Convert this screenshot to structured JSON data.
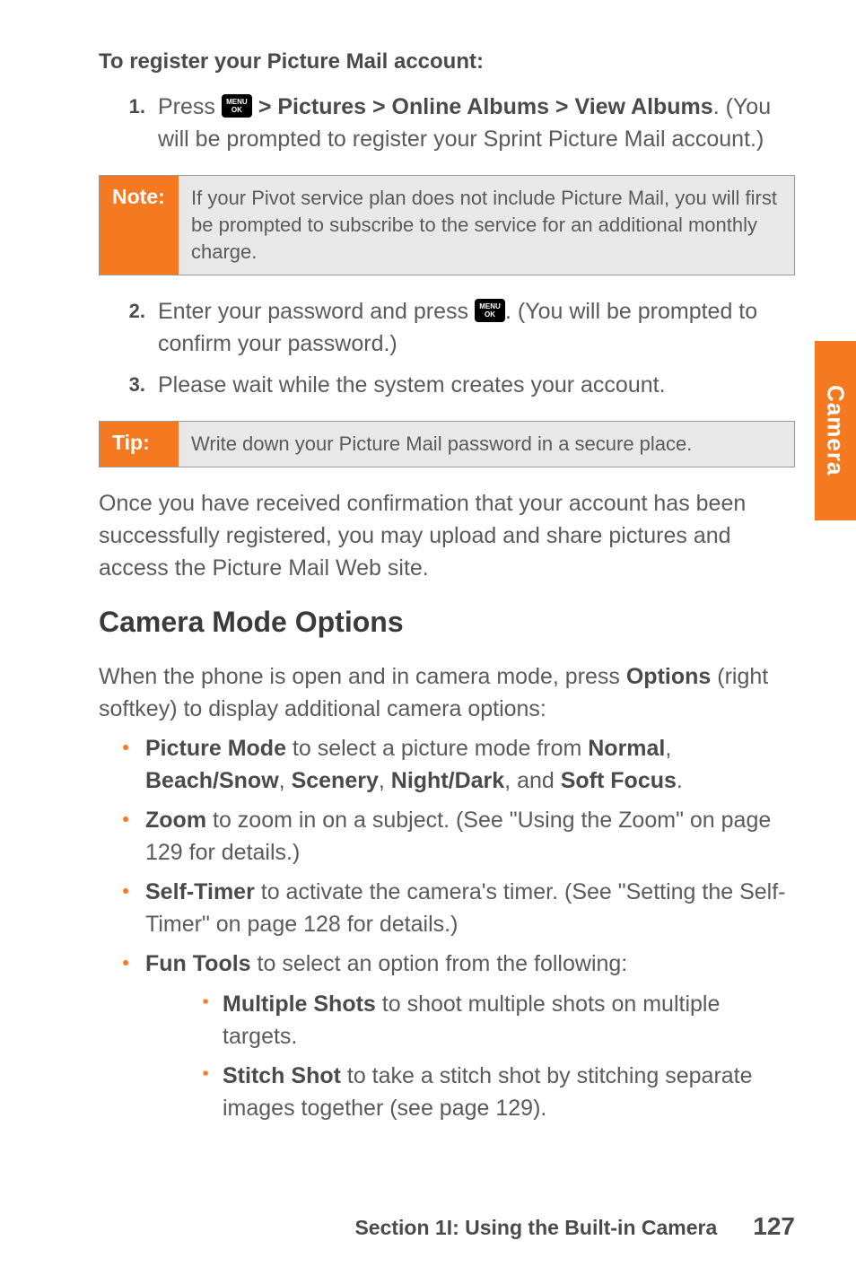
{
  "subheading": "To register your Picture Mail account:",
  "steps_block1": [
    {
      "num": "1.",
      "prefix": "Press ",
      "bold": " > Pictures > Online Albums > View Albums",
      "suffix": ". (You will be prompted to register your Sprint Picture Mail account.)",
      "has_icon": true
    }
  ],
  "note": {
    "label": "Note:",
    "body": "If your Pivot service plan does not include Picture Mail, you will first be prompted to subscribe to the service for an additional monthly charge."
  },
  "steps_block2": [
    {
      "num": "2.",
      "prefix": "Enter your password and press ",
      "suffix": ". (You will be prompted to confirm your password.)",
      "has_icon": true
    },
    {
      "num": "3.",
      "plain": "Please wait while the system creates your account."
    }
  ],
  "tip": {
    "label": "Tip:",
    "body": "Write down your Picture Mail password in a secure place."
  },
  "para1": "Once you have received confirmation that your account has been successfully registered, you may upload and share pictures and access the Picture Mail Web site.",
  "heading2": "Camera Mode Options",
  "para2_prefix": "When the phone is open and in camera mode, press ",
  "para2_bold": "Options",
  "para2_suffix": " (right softkey) to display additional camera options:",
  "bullets": [
    {
      "parts": [
        {
          "bold": "Picture Mode"
        },
        {
          "text": " to select a picture mode from "
        },
        {
          "bold": "Normal"
        },
        {
          "text": ", "
        },
        {
          "bold": "Beach/Snow"
        },
        {
          "text": ", "
        },
        {
          "bold": "Scenery"
        },
        {
          "text": ", "
        },
        {
          "bold": "Night/Dark"
        },
        {
          "text": ", and "
        },
        {
          "bold": "Soft Focus"
        },
        {
          "text": "."
        }
      ]
    },
    {
      "parts": [
        {
          "bold": "Zoom"
        },
        {
          "text": " to zoom in on a subject. (See \"Using the Zoom\" on page 129 for details.)"
        }
      ]
    },
    {
      "parts": [
        {
          "bold": "Self-Timer"
        },
        {
          "text": " to activate the camera's timer. (See \"Setting the Self-Timer\" on page 128 for details.)"
        }
      ]
    },
    {
      "parts": [
        {
          "bold": "Fun Tools"
        },
        {
          "text": " to select an option from the following:"
        }
      ],
      "subitems": [
        {
          "parts": [
            {
              "bold": "Multiple Shots"
            },
            {
              "text": " to shoot multiple shots on multiple targets."
            }
          ]
        },
        {
          "parts": [
            {
              "bold": "Stitch Shot"
            },
            {
              "text": " to take a stitch shot by stitching separate images together (see page 129)."
            }
          ]
        }
      ]
    }
  ],
  "menu_icon": {
    "top": "MENU",
    "bottom": "OK"
  },
  "sidebar_tab": "Camera",
  "footer": {
    "section": "Section 1I: Using the Built-in Camera",
    "page": "127"
  }
}
